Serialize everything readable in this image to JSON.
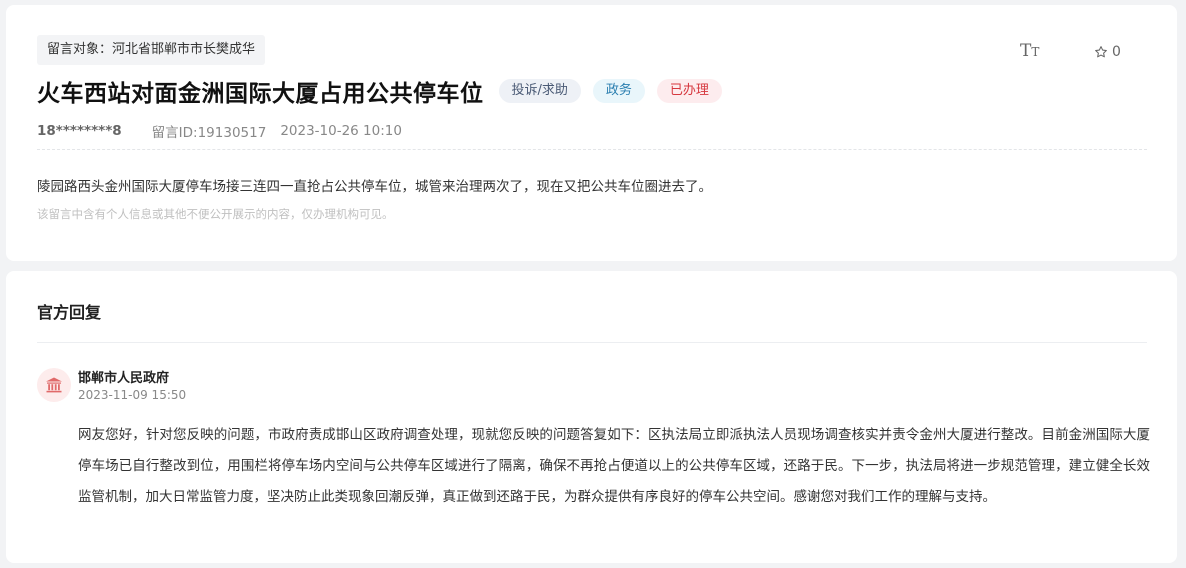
{
  "message": {
    "target_label": "留言对象：河北省邯郸市市长樊成华",
    "title": "火车西站对面金洲国际大厦占用公共停车位",
    "tags": {
      "type": "投诉/求助",
      "category": "政务",
      "status": "已办理"
    },
    "user": "18********8",
    "message_id": "留言ID:19130517",
    "datetime": "2023-10-26 10:10",
    "content": "陵园路西头金州国际大厦停车场接三连四一直抢占公共停车位，城管来治理两次了，现在又把公共车位圈进去了。",
    "privacy_notice": "该留言中含有个人信息或其他不便公开展示的内容，仅办理机构可见。"
  },
  "toolbar": {
    "font_icon": "font-size-icon",
    "star_icon": "star-icon",
    "star_count": "0"
  },
  "reply": {
    "heading": "官方回复",
    "org_icon": "government-building-icon",
    "org_name": "邯郸市人民政府",
    "time": "2023-11-09 15:50",
    "body": "网友您好，针对您反映的问题，市政府责成邯山区政府调查处理，现就您反映的问题答复如下：区执法局立即派执法人员现场调查核实并责令金州大厦进行整改。目前金洲国际大厦停车场已自行整改到位，用围栏将停车场内空间与公共停车区域进行了隔离，确保不再抢占便道以上的公共停车区域，还路于民。下一步，执法局将进一步规范管理，建立健全长效监管机制，加大日常监管力度，坚决防止此类现象回潮反弹，真正做到还路于民，为群众提供有序良好的停车公共空间。感谢您对我们工作的理解与支持。"
  },
  "colors": {
    "status_red": "#d6383f",
    "category_blue": "#2b7fb0",
    "avatar_red": "#e06a6a"
  }
}
